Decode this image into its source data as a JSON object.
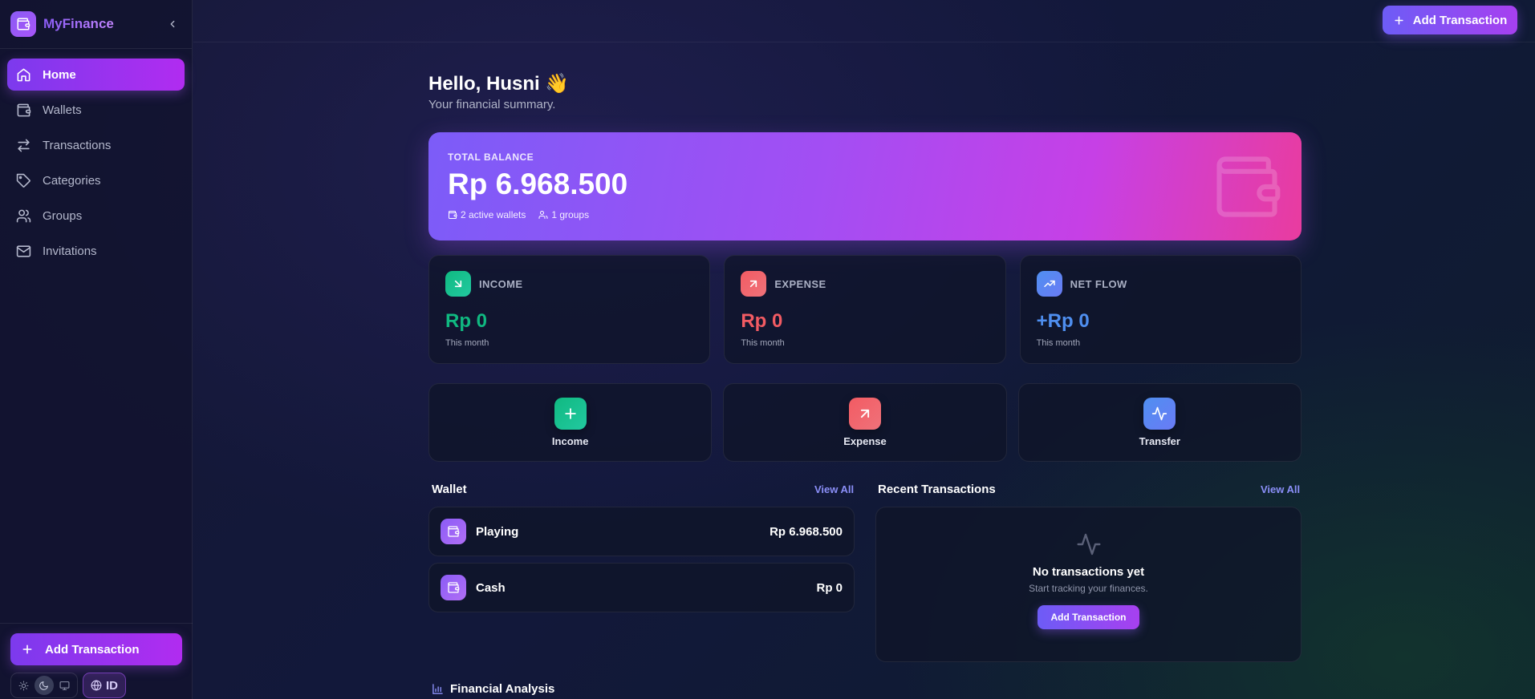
{
  "brand": {
    "name": "MyFinance"
  },
  "sidebar": {
    "items": [
      {
        "label": "Home",
        "icon": "home-icon",
        "active": true
      },
      {
        "label": "Wallets",
        "icon": "wallet-icon"
      },
      {
        "label": "Transactions",
        "icon": "arrows-icon"
      },
      {
        "label": "Categories",
        "icon": "tag-icon"
      },
      {
        "label": "Groups",
        "icon": "users-icon"
      },
      {
        "label": "Invitations",
        "icon": "mail-icon"
      }
    ],
    "add_label": "Add Transaction",
    "language": "ID"
  },
  "topbar": {
    "add_label": "Add Transaction"
  },
  "greeting": {
    "title": "Hello, Husni 👋",
    "subtitle": "Your financial summary."
  },
  "balance": {
    "label": "TOTAL BALANCE",
    "amount": "Rp 6.968.500",
    "wallets": "2 active wallets",
    "groups": "1 groups"
  },
  "stats": {
    "income": {
      "label": "INCOME",
      "value": "Rp 0",
      "sub": "This month",
      "color": "#10b981"
    },
    "expense": {
      "label": "EXPENSE",
      "value": "Rp 0",
      "sub": "This month",
      "color": "#f25b63"
    },
    "netflow": {
      "label": "NET FLOW",
      "value": "+Rp 0",
      "sub": "This month",
      "color": "#4f8ff0"
    }
  },
  "actions": {
    "income": "Income",
    "expense": "Expense",
    "transfer": "Transfer"
  },
  "wallet_section": {
    "title": "Wallet",
    "view_all": "View All",
    "items": [
      {
        "name": "Playing",
        "amount": "Rp 6.968.500"
      },
      {
        "name": "Cash",
        "amount": "Rp 0"
      }
    ]
  },
  "transactions_section": {
    "title": "Recent Transactions",
    "view_all": "View All",
    "empty_title": "No transactions yet",
    "empty_sub": "Start tracking your finances.",
    "add_label": "Add Transaction"
  },
  "analysis": {
    "title": "Financial Analysis"
  }
}
